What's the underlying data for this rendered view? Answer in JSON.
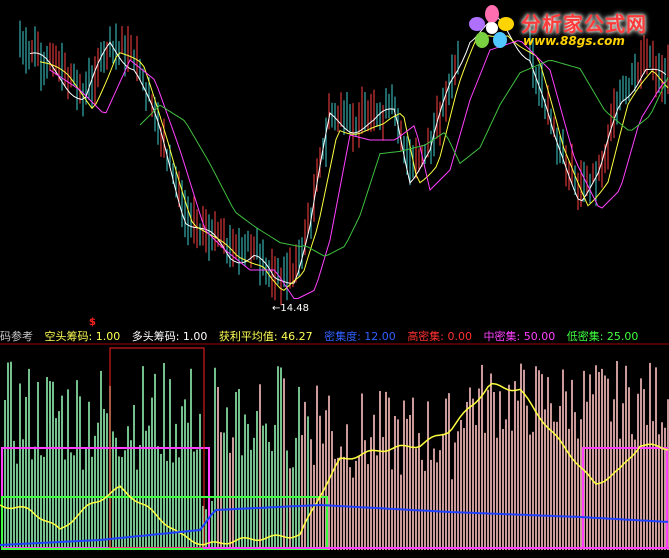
{
  "logo": {
    "brand": "分析家公式网",
    "url": "www.88gs.com",
    "colors": {
      "brand": "#ff3b3b",
      "url": "#ffd400"
    }
  },
  "annotations": {
    "low_price": "←14.48",
    "marker": "$"
  },
  "indicator_bar": {
    "items": [
      {
        "text": "码参考",
        "color": "#c8c8c8"
      },
      {
        "text": "空头筹码: 1.00",
        "color": "#ffff55"
      },
      {
        "text": "多头筹码: 1.00",
        "color": "#ffffff"
      },
      {
        "text": "获利平均值: 46.27",
        "color": "#ffff55"
      },
      {
        "text": "密集度: 12.00",
        "color": "#3060ff"
      },
      {
        "text": "高密集: 0.00",
        "color": "#ff3030"
      },
      {
        "text": "中密集: 50.00",
        "color": "#ff40ff"
      },
      {
        "text": "低密集: 25.00",
        "color": "#40ff40"
      }
    ]
  },
  "colors": {
    "background": "#000000",
    "up_candle": "#ff4040",
    "down_candle": "#40d0d0",
    "ma_white": "#ffffff",
    "ma_yellow": "#ffff40",
    "ma_magenta": "#ff40ff",
    "ma_green": "#40c040",
    "bar_green": "#90f0b0",
    "bar_pink": "#ffc0c0",
    "line_yellow": "#ffff40",
    "line_blue": "#2040ff",
    "box_magenta": "#ff40ff",
    "box_green": "#40ff40",
    "box_red": "#ff2020"
  }
}
